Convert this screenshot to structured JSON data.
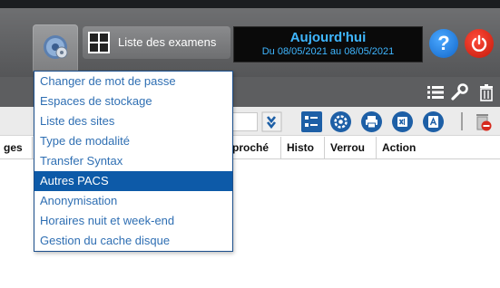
{
  "header": {
    "list_button_label": "Liste des examens",
    "today_title": "Aujourd'hui",
    "today_range": "Du 08/05/2021 au 08/05/2021",
    "help_label": "?"
  },
  "table_headers": [
    "ges",
    "proché",
    "Histo",
    "Verrou",
    "Action"
  ],
  "menu": {
    "items": [
      "Changer de mot de passe",
      "Espaces de stockage",
      "Liste des sites",
      "Type de modalité",
      "Transfer Syntax",
      "Autres PACS",
      "Anonymisation",
      "Horaires nuit et week-end",
      "Gestion du cache disque"
    ],
    "active_index": 5
  },
  "colors": {
    "accent_blue": "#0d5aa8",
    "today_text": "#3fb6ff",
    "help_blue": "#1266c9",
    "power_red": "#c21a0a",
    "menu_text": "#2f6fb3"
  },
  "icons": {
    "settings": "gear-icon",
    "list": "grid-icon",
    "help": "help-icon",
    "power": "power-icon",
    "subbar": [
      "list-icon",
      "wrench-icon",
      "trash-icon"
    ],
    "toolbar": [
      "select-icon",
      "columns-icon",
      "settings-icon",
      "print-icon",
      "excel-icon",
      "pdf-icon",
      "delete-icon"
    ]
  }
}
